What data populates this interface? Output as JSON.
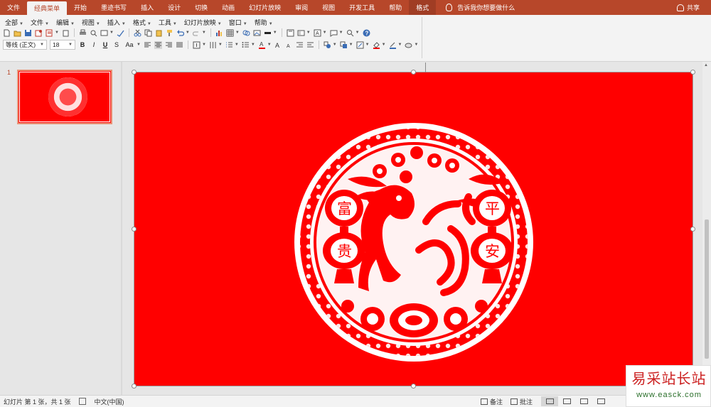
{
  "ribbon_tabs": [
    {
      "label": "文件"
    },
    {
      "label": "经典菜单"
    },
    {
      "label": "开始"
    },
    {
      "label": "墨迹书写"
    },
    {
      "label": "插入"
    },
    {
      "label": "设计"
    },
    {
      "label": "切换"
    },
    {
      "label": "动画"
    },
    {
      "label": "幻灯片放映"
    },
    {
      "label": "审阅"
    },
    {
      "label": "视图"
    },
    {
      "label": "开发工具"
    },
    {
      "label": "帮助"
    },
    {
      "label": "格式"
    }
  ],
  "active_tab": "经典菜单",
  "tell_me": "告诉我你想要做什么",
  "share": "共享",
  "classic_menu": [
    "全部",
    "文件",
    "编辑",
    "视图",
    "插入",
    "格式",
    "工具",
    "幻灯片放映",
    "窗口",
    "帮助"
  ],
  "font": {
    "name": "等线 (正文)",
    "size": "18"
  },
  "format_buttons": {
    "bold": "B",
    "italic": "I",
    "underline": "U",
    "strike": "S",
    "case": "Aa"
  },
  "slide_panel": {
    "slide_number": "1"
  },
  "slide_artwork": {
    "description_icon": "paper-cut-monkey-artwork",
    "left_lantern_chars": [
      "富",
      "贵"
    ],
    "right_lantern_chars": [
      "平",
      "安"
    ]
  },
  "status": {
    "slide_info": "幻灯片 第 1 张，共 1 张",
    "language": "中文(中国)",
    "notes": "备注",
    "comments": "批注"
  },
  "watermark": {
    "title": "易采站长站",
    "url": "www.easck.com"
  },
  "colors": {
    "ribbon": "#b7472a",
    "slide_bg": "#ff0000",
    "papercut": "#ffffff"
  }
}
